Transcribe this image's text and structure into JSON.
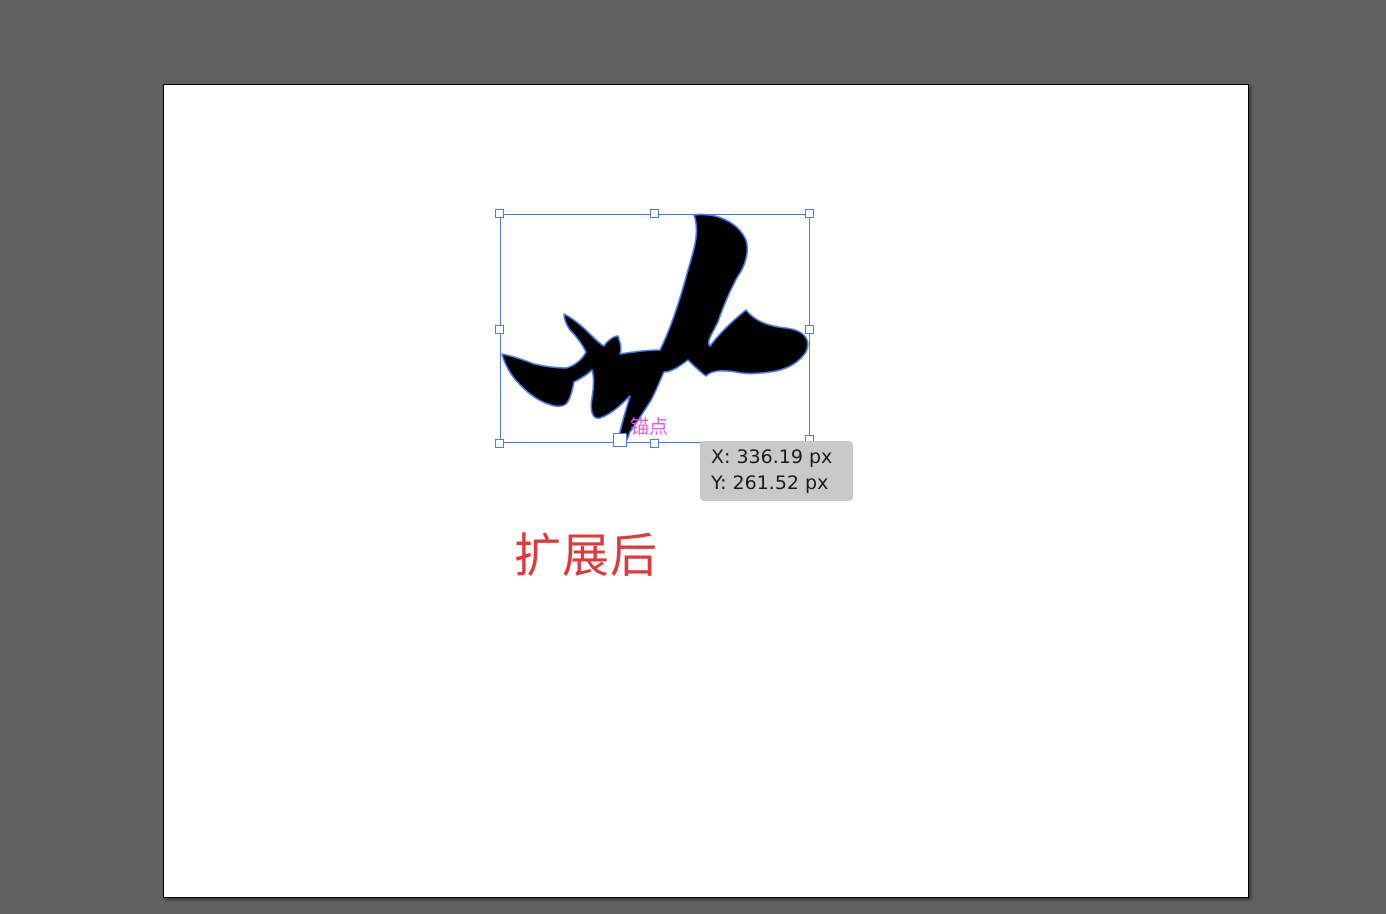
{
  "canvas": {
    "background_color": "#616161",
    "artboard_color": "#ffffff"
  },
  "selection": {
    "accent_color": "#4a7cf0",
    "anchor_label": "锚点",
    "anchor_label_color": "#e15ce6"
  },
  "tooltip": {
    "x_text": "X: 336.19 px",
    "y_text": "Y: 261.52 px"
  },
  "caption": {
    "text": "扩展后",
    "color": "#e0393c"
  }
}
